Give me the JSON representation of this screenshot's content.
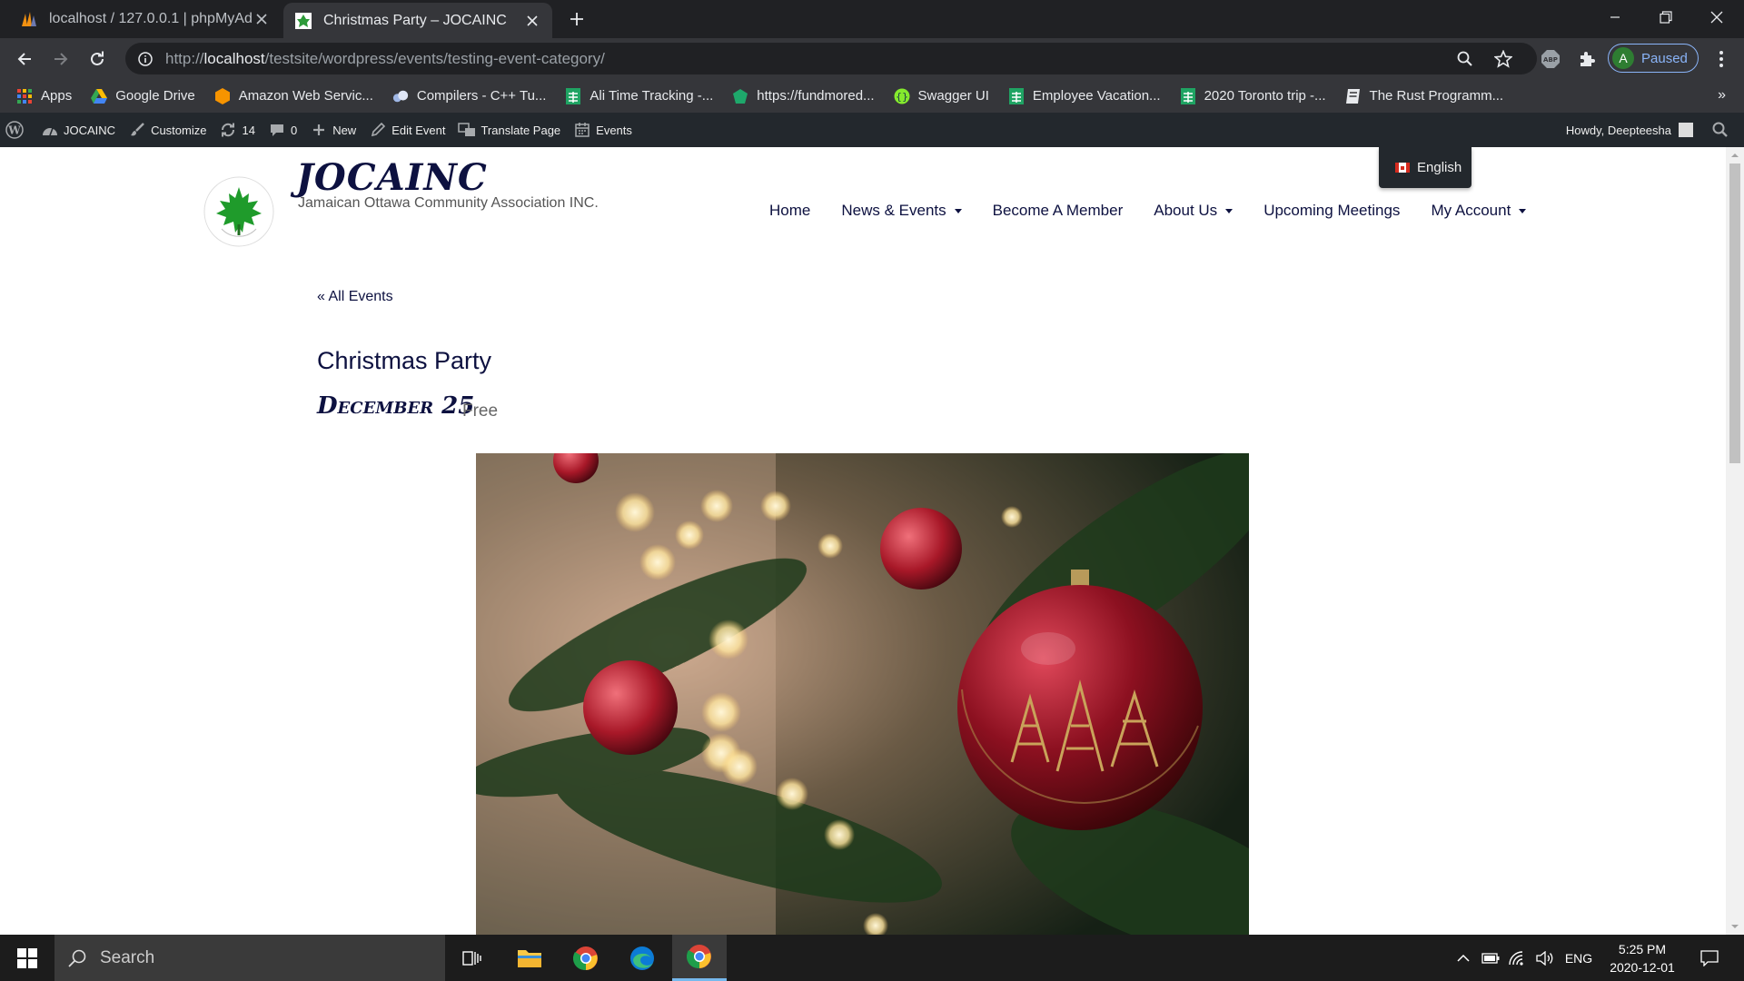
{
  "browser": {
    "tabs": [
      {
        "title": "localhost / 127.0.0.1 | phpMyAdmin",
        "active": false
      },
      {
        "title": "Christmas Party – JOCAINC",
        "active": true
      }
    ],
    "url_prefix": "http://",
    "url_host": "localhost",
    "url_path": "/testsite/wordpress/events/testing-event-category/",
    "profile_initial": "A",
    "profile_label": "Paused",
    "abp_label": "ABP"
  },
  "bookmarks": {
    "items": [
      {
        "label": "Apps",
        "icon": "apps-grid-icon"
      },
      {
        "label": "Google Drive",
        "icon": "google-drive-icon"
      },
      {
        "label": "Amazon Web Servic...",
        "icon": "aws-icon"
      },
      {
        "label": "Compilers - C++ Tu...",
        "icon": "compilers-icon"
      },
      {
        "label": "Ali Time Tracking -...",
        "icon": "sheets-icon"
      },
      {
        "label": "https://fundmored...",
        "icon": "fundmore-icon"
      },
      {
        "label": "Swagger UI",
        "icon": "swagger-icon"
      },
      {
        "label": "Employee Vacation...",
        "icon": "sheets-icon"
      },
      {
        "label": "2020 Toronto trip -...",
        "icon": "sheets-icon"
      },
      {
        "label": "The Rust Programm...",
        "icon": "book-icon"
      }
    ],
    "more": "»"
  },
  "wp_admin": {
    "site": "JOCAINC",
    "customize": "Customize",
    "updates": "14",
    "comments": "0",
    "new": "New",
    "edit_event": "Edit Event",
    "translate": "Translate Page",
    "events": "Events",
    "howdy": "Howdy, Deepteesha"
  },
  "site": {
    "title": "JOCAINC",
    "tagline": "Jamaican Ottawa Community Association INC.",
    "language": "English",
    "nav": [
      {
        "label": "Home",
        "dropdown": false
      },
      {
        "label": "News & Events",
        "dropdown": true
      },
      {
        "label": "Become A Member",
        "dropdown": false
      },
      {
        "label": "About Us",
        "dropdown": true
      },
      {
        "label": "Upcoming Meetings",
        "dropdown": false
      },
      {
        "label": "My Account",
        "dropdown": true
      }
    ],
    "logo_text": "The Jamaican Ottawa Community Association Inc."
  },
  "event": {
    "back_link": "« All Events",
    "title": "Christmas Party",
    "date": "December 25",
    "cost": "Free",
    "image_alt": "christmas-ornament-photo"
  },
  "taskbar": {
    "search_placeholder": "Search",
    "language": "ENG",
    "time": "5:25 PM",
    "date": "2020-12-01"
  },
  "colors": {
    "brand_navy": "#0d1140",
    "wp_bar": "#23282d",
    "chrome_dark": "#202124",
    "chrome_toolbar": "#35363a"
  }
}
